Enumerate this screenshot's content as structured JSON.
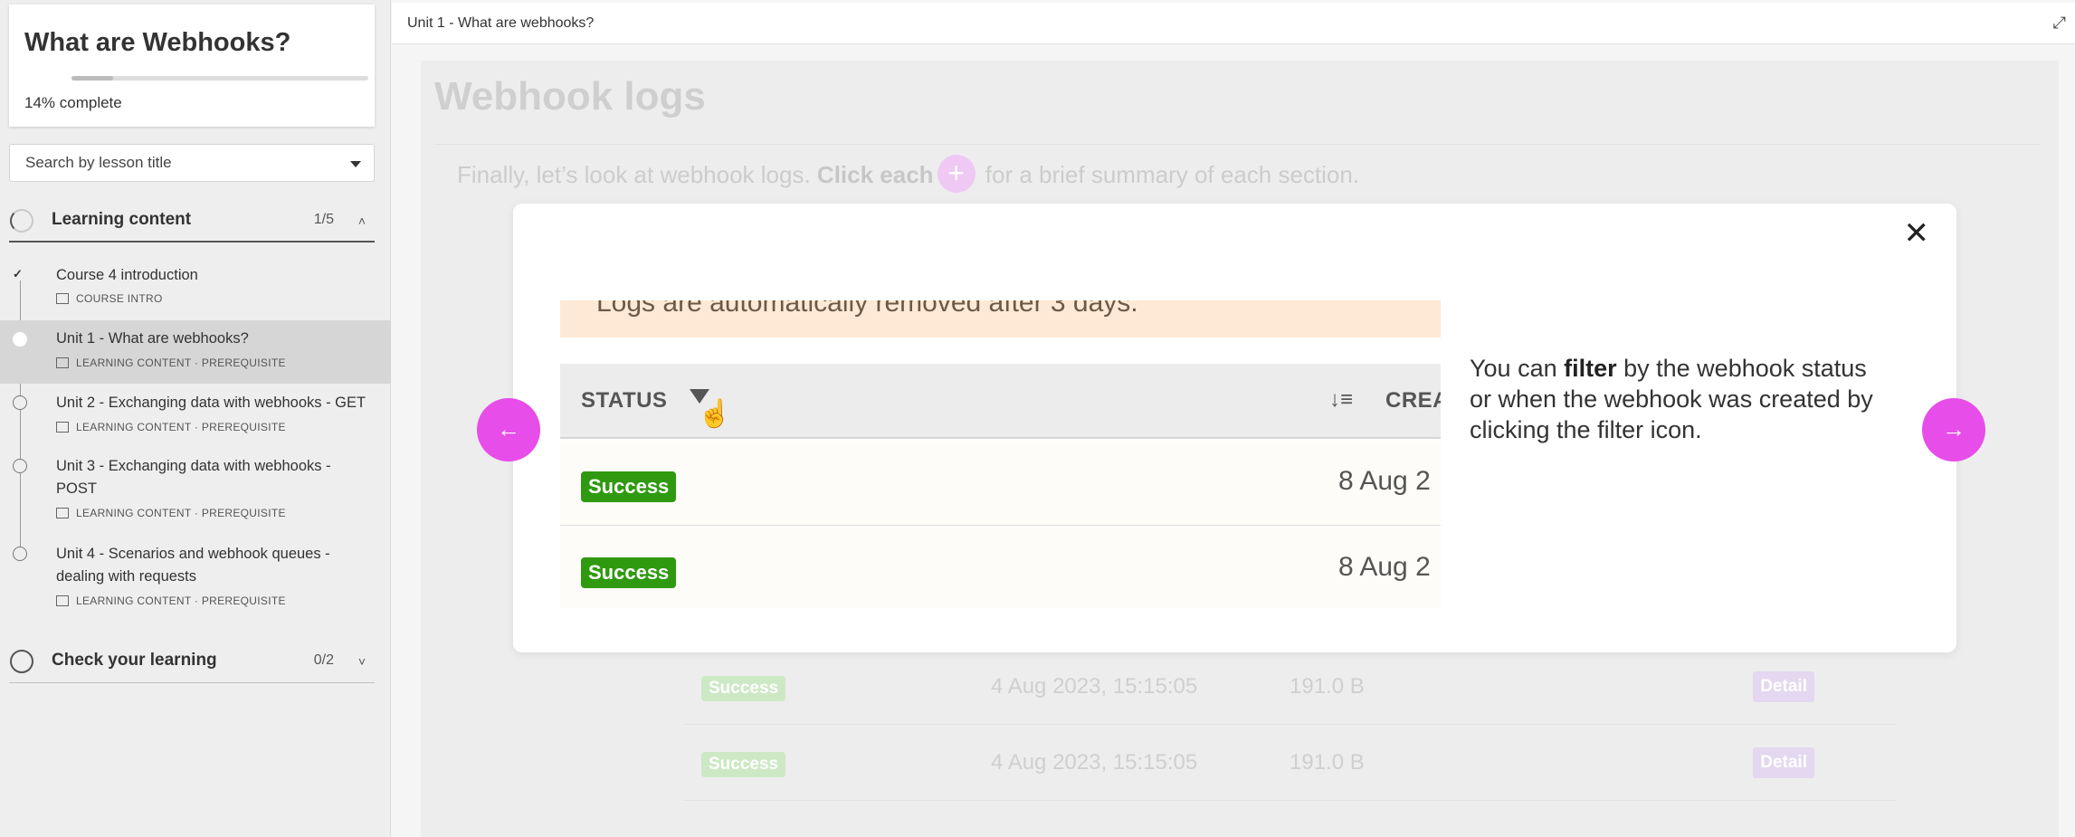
{
  "sidebar": {
    "course_title": "What are Webhooks?",
    "progress_percent": "14%",
    "progress_fraction": 0.14,
    "progress_suffix": " complete",
    "search_placeholder": "Search by lesson title",
    "sections": [
      {
        "label": "Learning content",
        "count": "1/5",
        "lessons": [
          {
            "title": "Course 4 introduction",
            "meta": "COURSE INTRO",
            "state": "done"
          },
          {
            "title": "Unit 1 - What are webhooks?",
            "meta": "LEARNING CONTENT · PREREQUISITE",
            "state": "active"
          },
          {
            "title": "Unit 2 - Exchanging data with webhooks - GET",
            "meta": "LEARNING CONTENT · PREREQUISITE",
            "state": "todo"
          },
          {
            "title": "Unit 3 - Exchanging data with webhooks - POST",
            "meta": "LEARNING CONTENT · PREREQUISITE",
            "state": "todo"
          },
          {
            "title": "Unit 4 - Scenarios and webhook queues - dealing with requests",
            "meta": "LEARNING CONTENT · PREREQUISITE",
            "state": "todo"
          }
        ]
      },
      {
        "label": "Check your learning",
        "count": "0/2"
      }
    ]
  },
  "main": {
    "breadcrumb": "Unit 1 - What are webhooks?",
    "page_heading": "Webhook logs",
    "intro_pre": "Finally, let’s look at webhook logs. ",
    "intro_bold": "Click each",
    "intro_post": " for a brief summary of each section.",
    "background_rows": [
      {
        "status": "Success",
        "date": "4 Aug 2023, 15:15:05",
        "size": "191.0 B",
        "action": "Detail"
      },
      {
        "status": "Success",
        "date": "4 Aug 2023, 15:15:05",
        "size": "191.0 B",
        "action": "Detail"
      }
    ]
  },
  "modal": {
    "close_icon": "close-icon",
    "screenshot": {
      "notice": "Logs are automatically removed after 3 days.",
      "col_status": "STATUS",
      "col_created": "CREA",
      "rows": [
        {
          "status": "Success",
          "date": "8 Aug 2"
        },
        {
          "status": "Success",
          "date": "8 Aug 2"
        }
      ]
    },
    "text_pre": "You can ",
    "text_bold": "filter",
    "text_post": " by the webhook status or when the webhook was created by clicking the filter icon."
  },
  "colors": {
    "accent": "#e74de8",
    "success": "#2f9a0f",
    "notice_bg": "#fde9d6"
  }
}
